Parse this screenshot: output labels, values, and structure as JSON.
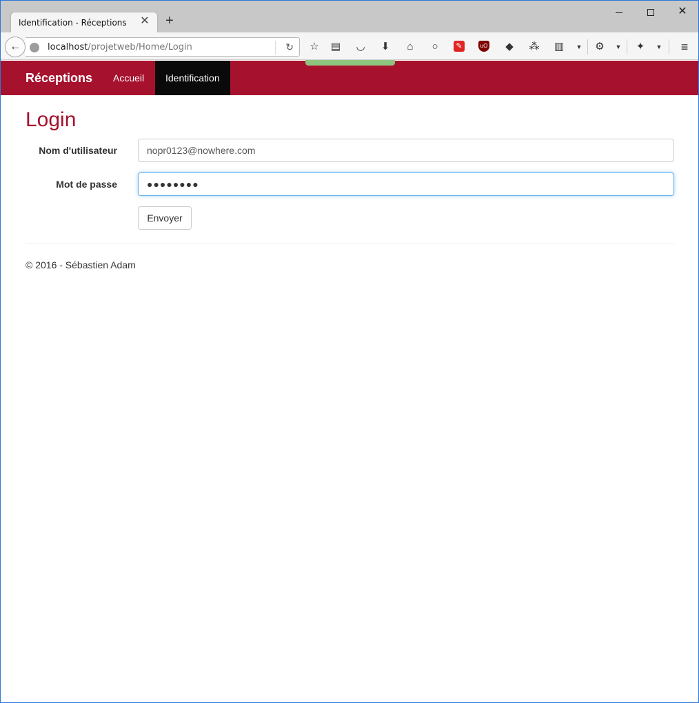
{
  "browser": {
    "tab_title": "Identification - Réceptions",
    "tab_close": "✕",
    "new_tab": "+",
    "url_host": "localhost",
    "url_path": "/projetweb/Home/Login",
    "icons": [
      "star-icon",
      "reading-list-icon",
      "pocket-icon",
      "download-icon",
      "home-icon",
      "chat-icon",
      "adobe-icon",
      "ublock-icon",
      "eraser-icon",
      "network-icon",
      "clipboard-icon",
      "gear-icon",
      "extension-icon",
      "menu-icon"
    ]
  },
  "navbar": {
    "brand": "Réceptions",
    "links": [
      {
        "label": "Accueil"
      },
      {
        "label": "Identification",
        "active": true
      }
    ],
    "color": "#a6112d"
  },
  "main": {
    "title": "Login",
    "form": {
      "username_label": "Nom d'utilisateur",
      "username_value": "nopr0123@nowhere.com",
      "password_label": "Mot de passe",
      "password_value": "●●●●●●●●",
      "submit_label": "Envoyer"
    }
  },
  "footer": {
    "text": "© 2016 - Sébastien Adam"
  }
}
